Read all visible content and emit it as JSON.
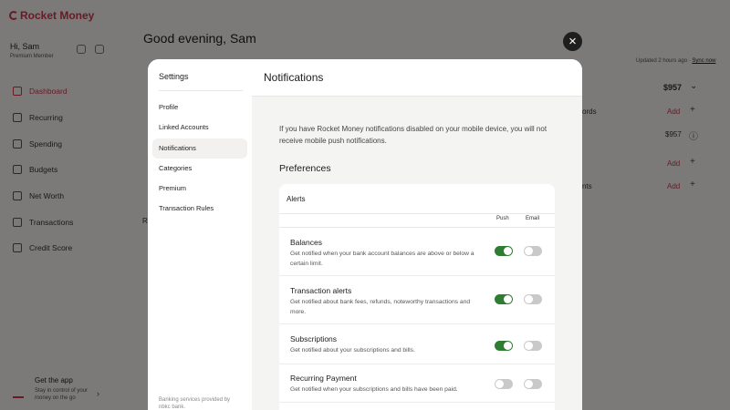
{
  "app": {
    "brand": "Rocket Money",
    "user_name": "Hi, Sam",
    "user_plan": "Premium Member",
    "nav": [
      "Dashboard",
      "Recurring",
      "Spending",
      "Budgets",
      "Net Worth",
      "Transactions",
      "Credit Score"
    ],
    "active_nav": "Dashboard",
    "get_app_title": "Get the app",
    "get_app_desc": "Stay in control of your money on the go",
    "greeting": "Good evening, Sam",
    "updated_text": "Updated 2 hours ago",
    "sync_label": "Sync now",
    "amount_1": "$957",
    "amount_2": "$957",
    "row_label_1": "ords",
    "row_label_2": "nts",
    "add_label": "Add",
    "partial_label": "R"
  },
  "modal": {
    "close_label": "×",
    "sidebar_title": "Settings",
    "menu": [
      "Profile",
      "Linked Accounts",
      "Notifications",
      "Categories",
      "Premium",
      "Transaction Rules"
    ],
    "active_menu": "Notifications",
    "footer": "Banking services provided by nbkc bank.",
    "title": "Notifications",
    "info": "If you have Rocket Money notifications disabled on your mobile device, you will not receive mobile push notifications.",
    "preferences_heading": "Preferences",
    "alerts_title": "Alerts",
    "col_push": "Push",
    "col_email": "Email",
    "rows": [
      {
        "title": "Balances",
        "desc": "Get notified when your bank account balances are above or below a certain limit.",
        "push": true,
        "email": false
      },
      {
        "title": "Transaction alerts",
        "desc": "Get notified about bank fees, refunds, noteworthy transactions and more.",
        "push": true,
        "email": false
      },
      {
        "title": "Subscriptions",
        "desc": "Get notified about your subscriptions and bills.",
        "push": true,
        "email": false
      },
      {
        "title": "Recurring Payment",
        "desc": "Get notified when your subscriptions and bills have been paid.",
        "push": false,
        "email": false
      }
    ]
  },
  "colors": {
    "brand_red": "#d0354a",
    "toggle_on": "#2e7d32",
    "toggle_off": "#c9c9c9"
  }
}
